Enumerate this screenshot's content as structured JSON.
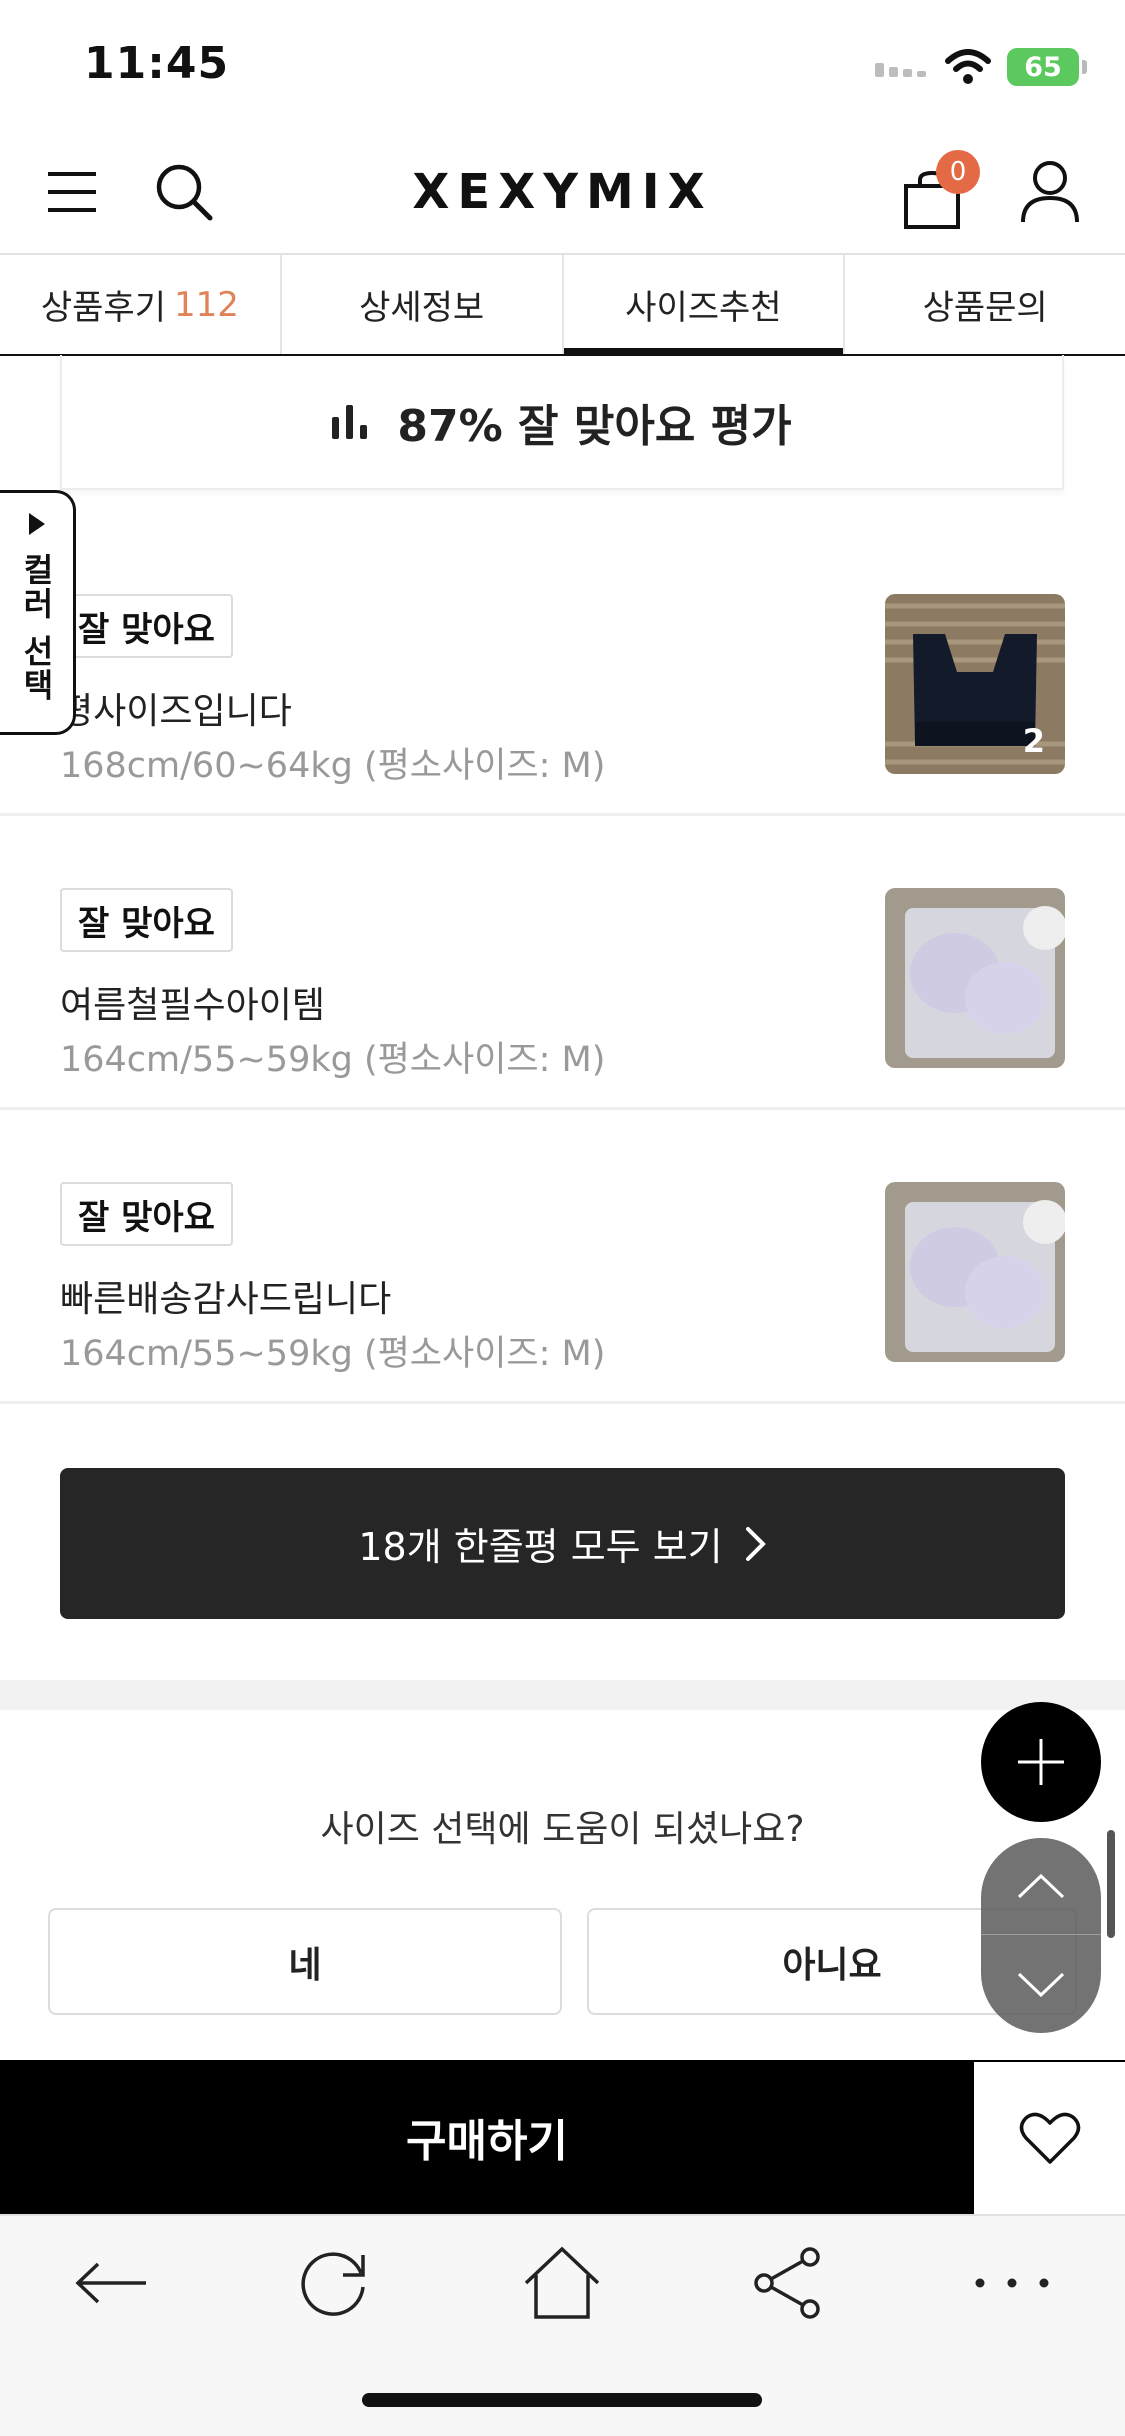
{
  "status_bar": {
    "time": "11:45",
    "battery": "65"
  },
  "header": {
    "logo": "XEXYMIX",
    "cart_count": "0"
  },
  "tabs": [
    {
      "label": "상품후기",
      "count": "112"
    },
    {
      "label": "상세정보"
    },
    {
      "label": "사이즈추천",
      "active": true
    },
    {
      "label": "상품문의"
    }
  ],
  "summary": {
    "text": "87% 잘 맞아요 평가"
  },
  "color_tab": {
    "label": "컬러 선택"
  },
  "reviews": [
    {
      "badge": "잘 맞아요",
      "text": "평사이즈입니다",
      "meta": "168cm/60~64kg (평소사이즈: M)",
      "photo_count": "2"
    },
    {
      "badge": "잘 맞아요",
      "text": "여름철필수아이템",
      "meta": "164cm/55~59kg (평소사이즈: M)"
    },
    {
      "badge": "잘 맞아요",
      "text": "빠른배송감사드립니다",
      "meta": "164cm/55~59kg (평소사이즈: M)"
    }
  ],
  "view_all": {
    "label": "18개 한줄평 모두 보기"
  },
  "helpful": {
    "question": "사이즈 선택에 도움이 되셨나요?",
    "yes": "네",
    "no": "아니요"
  },
  "buy_bar": {
    "buy_label": "구매하기"
  },
  "colors": {
    "accent": "#e46a46",
    "count": "#e08358",
    "battery": "#5cc95f",
    "dark_button": "#262626"
  }
}
